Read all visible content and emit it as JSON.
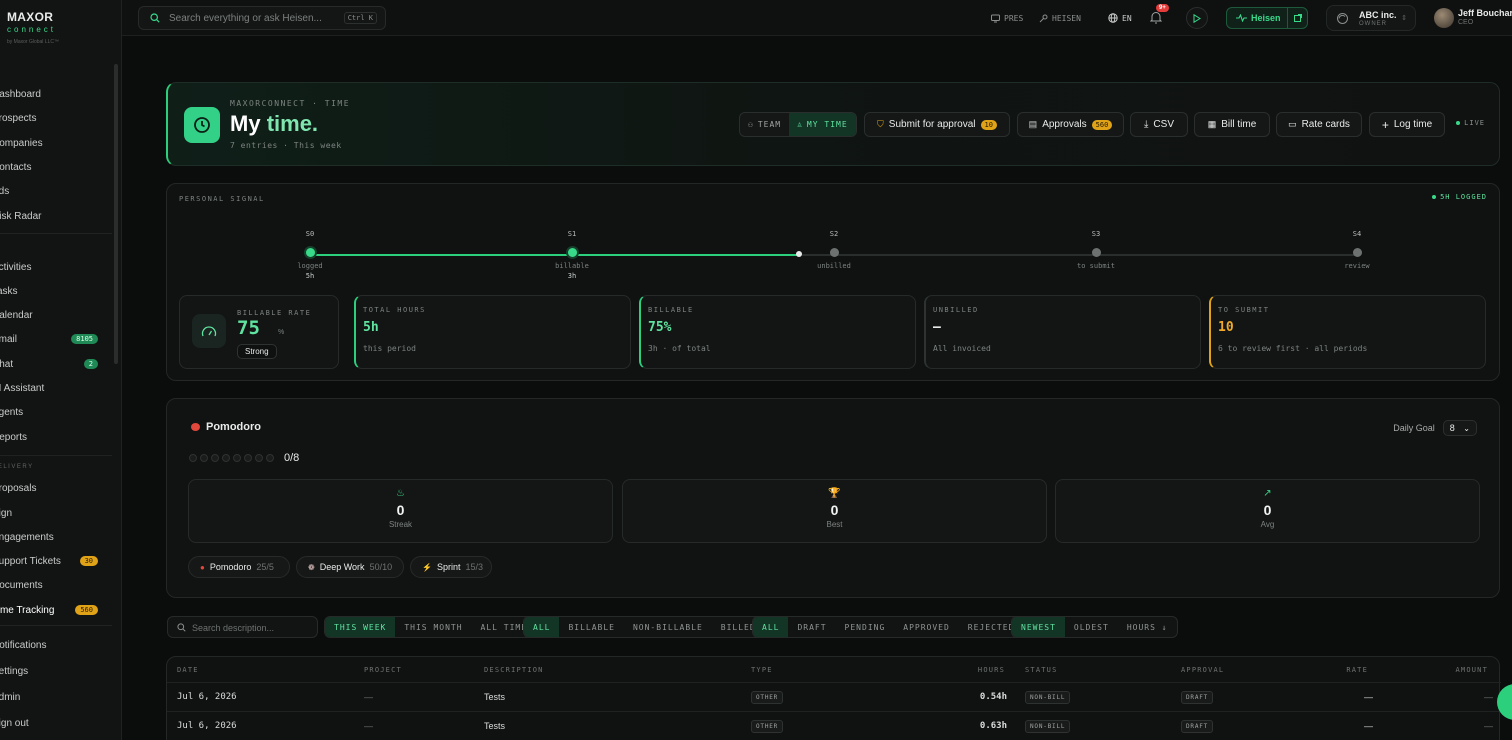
{
  "sidebar": {
    "brand": {
      "name": "MAXOR",
      "sub": "connect",
      "tagline": "by Maxor Global LLC™"
    },
    "items": [
      {
        "label": "Dashboard"
      },
      {
        "label": "Prospects"
      },
      {
        "label": "Companies"
      },
      {
        "label": "Contacts"
      },
      {
        "label": "Ads"
      },
      {
        "label": "Risk Radar"
      },
      {
        "label": "Activities"
      },
      {
        "label": "Tasks"
      },
      {
        "label": "Calendar"
      },
      {
        "label": "Email",
        "badge": "8105"
      },
      {
        "label": "Chat",
        "badge": "2"
      },
      {
        "label": "AI Assistant"
      },
      {
        "label": "Agents"
      },
      {
        "label": "Reports"
      },
      {
        "label": "Proposals"
      },
      {
        "label": "Sign"
      },
      {
        "label": "Engagements"
      },
      {
        "label": "Support Tickets",
        "badge": "30"
      },
      {
        "label": "Documents"
      },
      {
        "label": "Time Tracking",
        "badge": "560"
      },
      {
        "label": "Notifications"
      },
      {
        "label": "Settings"
      },
      {
        "label": "Admin"
      },
      {
        "label": "Sign out"
      }
    ],
    "section_label": "DELIVERY"
  },
  "topbar": {
    "search_placeholder": "Search everything or ask Heisen...",
    "search_shortcut": "Ctrl K",
    "pres": "PRES",
    "heisen_link": "HEISEN",
    "lang": "EN",
    "notif_badge": "9+",
    "heisen_button": "Heisen",
    "org": {
      "name": "ABC inc.",
      "role": "OWNER"
    },
    "user": {
      "name": "Jeff Bouchar",
      "role": "CEO"
    }
  },
  "hero": {
    "kicker": "MAXORCONNECT · TIME",
    "title_a": "My",
    "title_b": "time.",
    "subtitle": "7 entries · This week",
    "seg_team": "TEAM",
    "seg_mytime": "MY TIME",
    "submit_label": "Submit for approval",
    "submit_badge": "10",
    "approvals_label": "Approvals",
    "approvals_badge": "560",
    "csv_label": "CSV",
    "bill_label": "Bill time",
    "rate_label": "Rate cards",
    "log_label": "Log time",
    "live": "LIVE"
  },
  "signal": {
    "title": "PERSONAL SIGNAL",
    "badge": "5H LOGGED",
    "progress_fraction": 0.467,
    "stages": [
      {
        "code": "S0",
        "caption": "logged",
        "value": "5h",
        "active": true
      },
      {
        "code": "S1",
        "caption": "billable",
        "value": "3h",
        "active": true
      },
      {
        "code": "S2",
        "caption": "unbilled",
        "value": "",
        "active": false
      },
      {
        "code": "S3",
        "caption": "to submit",
        "value": "",
        "active": false
      },
      {
        "code": "S4",
        "caption": "review",
        "value": "",
        "active": false
      }
    ],
    "rate": {
      "label": "BILLABLE RATE",
      "value": "75",
      "unit": "%",
      "pill": "Strong"
    },
    "stats": [
      {
        "label": "TOTAL HOURS",
        "value": "5h",
        "sub": "this period",
        "color": "#5fe3a0",
        "accent": "#2ccf7c"
      },
      {
        "label": "BILLABLE",
        "value": "75%",
        "sub": "3h · of total",
        "color": "#5fe3a0",
        "accent": "#2ccf7c"
      },
      {
        "label": "UNBILLED",
        "value": "—",
        "sub": "All invoiced",
        "color": "#e8ebea",
        "accent": "#2e3231"
      },
      {
        "label": "TO SUBMIT",
        "value": "10",
        "sub": "6 to review first · all periods",
        "color": "#f0a92a",
        "accent": "#e0a318"
      }
    ]
  },
  "pomodoro": {
    "title": "Pomodoro",
    "goal_label": "Daily Goal",
    "goal_value": "8",
    "progress": "0/8",
    "kpis": [
      {
        "icon": "flame-icon",
        "glyph": "♨",
        "value": "0",
        "label": "Streak"
      },
      {
        "icon": "trophy-icon",
        "glyph": "🏆",
        "value": "0",
        "label": "Best"
      },
      {
        "icon": "trend-up-icon",
        "glyph": "↗",
        "value": "0",
        "label": "Avg"
      }
    ],
    "modes": [
      {
        "label": "Pomodoro",
        "count": "25/5"
      },
      {
        "label": "Deep Work",
        "count": "50/10"
      },
      {
        "label": "Sprint",
        "count": "15/3"
      }
    ]
  },
  "filters": {
    "search_placeholder": "Search description...",
    "period": [
      "THIS WEEK",
      "THIS MONTH",
      "ALL TIME"
    ],
    "billing": [
      "ALL",
      "BILLABLE",
      "NON-BILLABLE",
      "BILLED"
    ],
    "status": [
      "ALL",
      "DRAFT",
      "PENDING",
      "APPROVED",
      "REJECTED"
    ],
    "sort": [
      "NEWEST",
      "OLDEST",
      "HOURS ↓"
    ]
  },
  "table": {
    "headers": {
      "date": "DATE",
      "project": "PROJECT",
      "description": "DESCRIPTION",
      "type": "TYPE",
      "hours": "HOURS",
      "status": "STATUS",
      "approval": "APPROVAL",
      "rate": "RATE",
      "amount": "AMOUNT"
    },
    "rows": [
      {
        "date": "Jul 6, 2026",
        "project": "—",
        "description": "Tests",
        "type": "OTHER",
        "hours": "0.54h",
        "status": "NON-BILL",
        "approval": "DRAFT",
        "rate": "—",
        "amount": "—"
      },
      {
        "date": "Jul 6, 2026",
        "project": "—",
        "description": "Tests",
        "type": "OTHER",
        "hours": "0.63h",
        "status": "NON-BILL",
        "approval": "DRAFT",
        "rate": "—",
        "amount": "—"
      }
    ]
  }
}
